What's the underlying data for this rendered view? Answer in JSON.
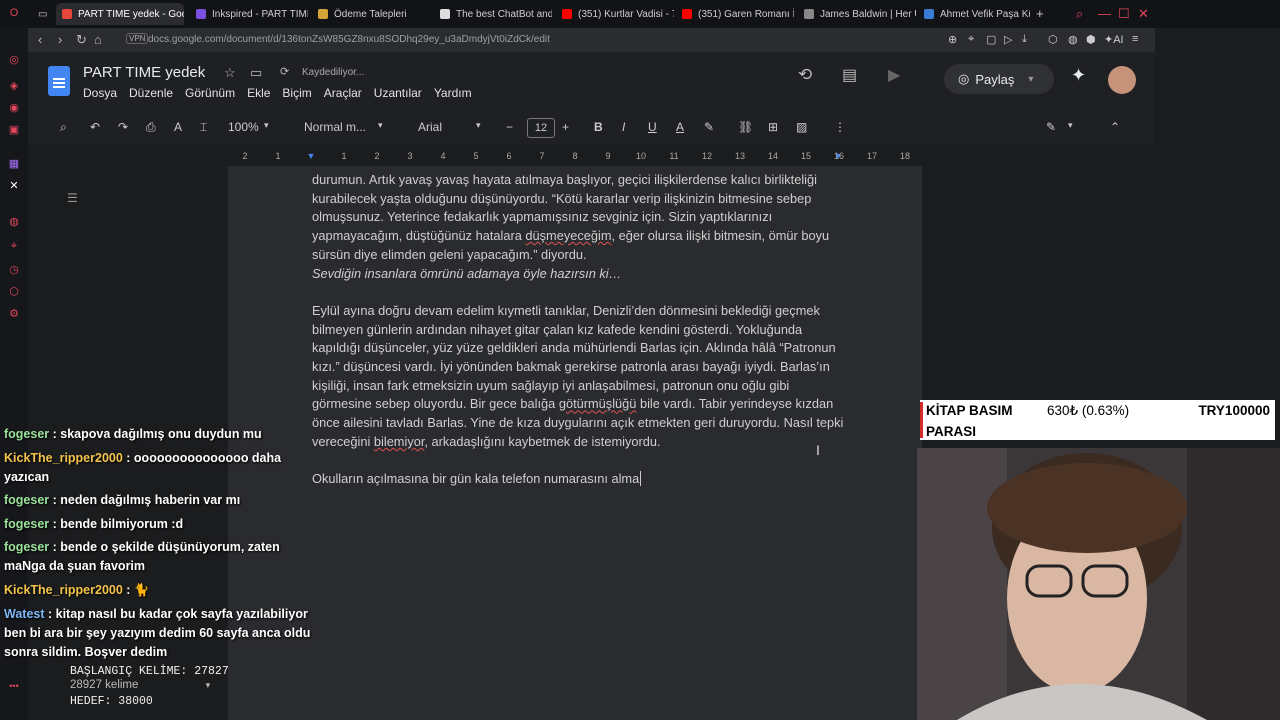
{
  "browser": {
    "tabs": [
      {
        "label": "PART TIME yedek - Google",
        "active": true,
        "color": "#e8453c"
      },
      {
        "label": "Inkspired - PART TIME",
        "active": false,
        "color": "#7b4fe0"
      },
      {
        "label": "Ödeme Talepleri",
        "active": false,
        "color": "#d6a53a"
      },
      {
        "label": "The best ChatBot and",
        "active": false,
        "color": "#dddddd"
      },
      {
        "label": "(351) Kurtlar Vadisi - 7",
        "active": false,
        "color": "#ff0000"
      },
      {
        "label": "(351) Garen Romanı İle",
        "active": false,
        "color": "#ff0000"
      },
      {
        "label": "James Baldwin | Her U",
        "active": false,
        "color": "#888888"
      },
      {
        "label": "Ahmet Vefik Paşa Kültü",
        "active": false,
        "color": "#3a7bd5"
      }
    ],
    "new_tab": "+",
    "vpn": "VPN",
    "url": "docs.google.com/document/d/136tonZsW85GZ8nxu8SODhq29ey_u3aDmdyjVt0iZdCk/edit",
    "ai_label": "AI"
  },
  "docs": {
    "title": "PART TIME yedek",
    "save_status": "Kaydediliyor...",
    "menus": [
      "Dosya",
      "Düzenle",
      "Görünüm",
      "Ekle",
      "Biçim",
      "Araçlar",
      "Uzantılar",
      "Yardım"
    ],
    "share_label": "Paylaş",
    "toolbar": {
      "zoom": "100%",
      "style": "Normal m...",
      "font": "Arial",
      "font_size": "12"
    },
    "ruler": [
      "2",
      "1",
      "1",
      "2",
      "3",
      "4",
      "5",
      "6",
      "7",
      "8",
      "9",
      "10",
      "11",
      "12",
      "13",
      "14",
      "15",
      "16",
      "17",
      "18"
    ],
    "paragraphs": [
      {
        "text": "durumun. Artık yavaş yavaş hayata atılmaya başlıyor, geçici ilişkilerdense kalıcı birlikteliği kurabilecek yaşta olduğunu düşünüyordu. “Kötü kararlar verip ilişkinizin bitmesine sebep olmuşsunuz. Yeterince fedakarlık yapmamışsınız sevginiz için. Sizin yaptıklarınızı yapmayacağım, düştüğünüz hatalara ",
        "underlined": "düşmeyeceğim",
        "after": ", eğer olursa ilişki bitmesin, ömür boyu sürsün diye elimden geleni yapacağım.” diyordu."
      },
      {
        "text": "Sevdiğin insanlara ömrünü adamaya öyle hazırsın ki…",
        "italic": true
      },
      {
        "text": "Eylül ayına doğru devam edelim kıymetli tanıklar, Denizli’den dönmesini beklediği geçmek bilmeyen günlerin ardından nihayet gitar çalan kız kafede kendini gösterdi. Yokluğunda kapıldığı düşünceler, yüz yüze geldikleri anda mühürlendi Barlas için. Aklında hâlâ “Patronun kızı.” düşüncesi vardı. İyi yönünden bakmak gerekirse patronla arası bayağı iyiydi. Barlas’ın kişiliği, insan fark etmeksizin uyum sağlayıp iyi anlaşabilmesi, patronun onu oğlu gibi görmesine sebep oluyordu. Bir gece balığa ",
        "underlined": "götürmüşlüğü",
        "after": " bile vardı. Tabir yerindeyse kızdan önce ailesini tavladı Barlas. Yine de kıza duygularını açık etmekten geri duruyordu. Nasıl tepki vereceğini ",
        "underlined2": "bilemiyor",
        "after2": ", arkadaşlığını kaybetmek de istemiyordu."
      },
      {
        "text": "Okulların açılmasına bir gün kala telefon numarasını alma"
      }
    ]
  },
  "overlay": {
    "ticker_name_line1": "KİTAP BASIM",
    "ticker_name_line2": "PARASI",
    "ticker_change": "630₺ (0.63%)",
    "ticker_target": "TRY100000"
  },
  "chat": [
    {
      "user": "fogeser",
      "text": " : skapova dağılmış onu duydun mu",
      "style": ""
    },
    {
      "user": "KickThe_ripper2000",
      "text": " : ooooooooooooooo daha yazıcan",
      "style": "alt"
    },
    {
      "user": "fogeser",
      "text": " : neden dağılmış haberin var mı",
      "style": ""
    },
    {
      "user": "fogeser",
      "text": " : bende bilmiyorum :d",
      "style": ""
    },
    {
      "user": "fogeser",
      "text": " : bende o şekilde düşünüyorum, zaten maNga da şuan favorim",
      "style": ""
    },
    {
      "user": "KickThe_ripper2000",
      "text": " : 🐈",
      "style": "alt"
    },
    {
      "user": "Watest",
      "text": " : kitap nasıl bu kadar çok sayfa yazılabiliyor ben bi ara bir şey yazıyım dedim 60 sayfa anca oldu sonra sildim. Boşver dedim",
      "style": "blue"
    }
  ],
  "counters": {
    "start_label": "BAŞLANGIÇ KELİME: 27827",
    "word_count": "28927 kelime",
    "target_label": "HEDEF: 38000"
  }
}
